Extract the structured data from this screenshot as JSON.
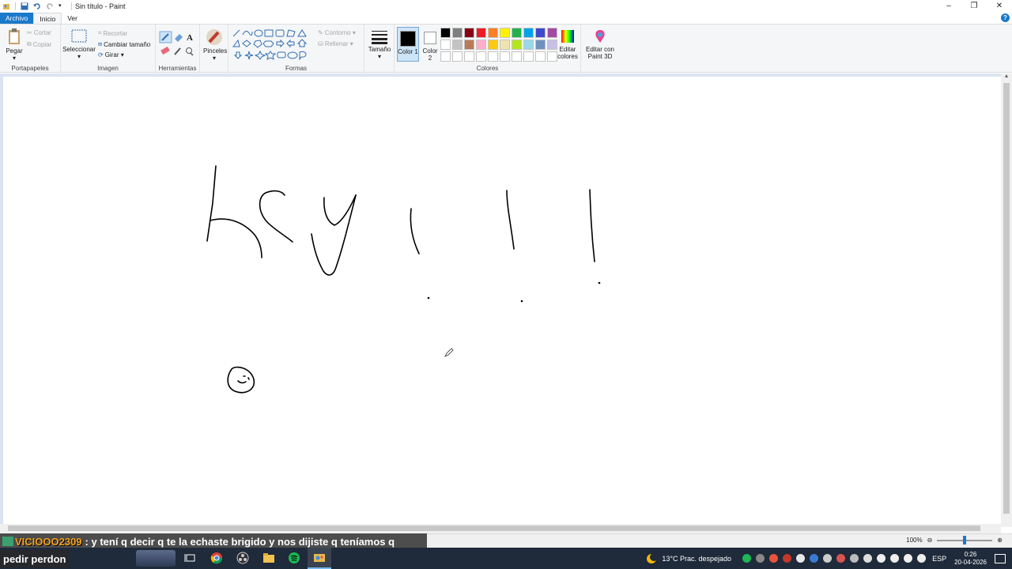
{
  "window": {
    "title": "Sin título - Paint",
    "controls": [
      "–",
      "❐",
      "✕"
    ]
  },
  "tabs": {
    "file": "Archivo",
    "home": "Inicio",
    "view": "Ver"
  },
  "ribbon": {
    "clipboard": {
      "paste": "Pegar",
      "cut": "Cortar",
      "copy": "Copiar",
      "label": "Portapapeles"
    },
    "image": {
      "select": "Seleccionar",
      "crop": "Recortar",
      "resize": "Cambiar tamaño",
      "rotate": "Girar ▾",
      "label": "Imagen"
    },
    "tools": {
      "label": "Herramientas"
    },
    "brushes": {
      "label": "Pinceles"
    },
    "shapes": {
      "outline": "Contorno ▾",
      "fill": "Rellenar ▾",
      "label": "Formas"
    },
    "size": {
      "label": "Tamaño"
    },
    "colors": {
      "color1": "Color 1",
      "color2": "Color 2",
      "edit": "Editar colores",
      "paint3d": "Editar con Paint 3D",
      "label": "Colores",
      "palette": [
        "#000000",
        "#7f7f7f",
        "#880015",
        "#ed1c24",
        "#ff7f27",
        "#fff200",
        "#22b14c",
        "#00a2e8",
        "#3f48cc",
        "#a349a4",
        "#ffffff",
        "#c3c3c3",
        "#b97a57",
        "#ffaec9",
        "#ffc90e",
        "#efe4b0",
        "#b5e61d",
        "#99d9ea",
        "#7092be",
        "#c8bfe7",
        "#ffffff",
        "#ffffff",
        "#ffffff",
        "#ffffff",
        "#ffffff",
        "#ffffff",
        "#ffffff",
        "#ffffff",
        "#ffffff",
        "#ffffff"
      ],
      "color1_value": "#000000",
      "color2_value": "#ffffff"
    }
  },
  "status": {
    "zoom": "100%"
  },
  "chat": {
    "username": "VICIOOO2309",
    "message": ": y tení q decir q te la echaste brigido y nos dijiste q teníamos q",
    "message_cont": "pedir perdon"
  },
  "taskbar": {
    "weather": "13°C  Prac. despejado",
    "lang": "ESP",
    "time": "0:26",
    "date": "20-04-2026"
  }
}
